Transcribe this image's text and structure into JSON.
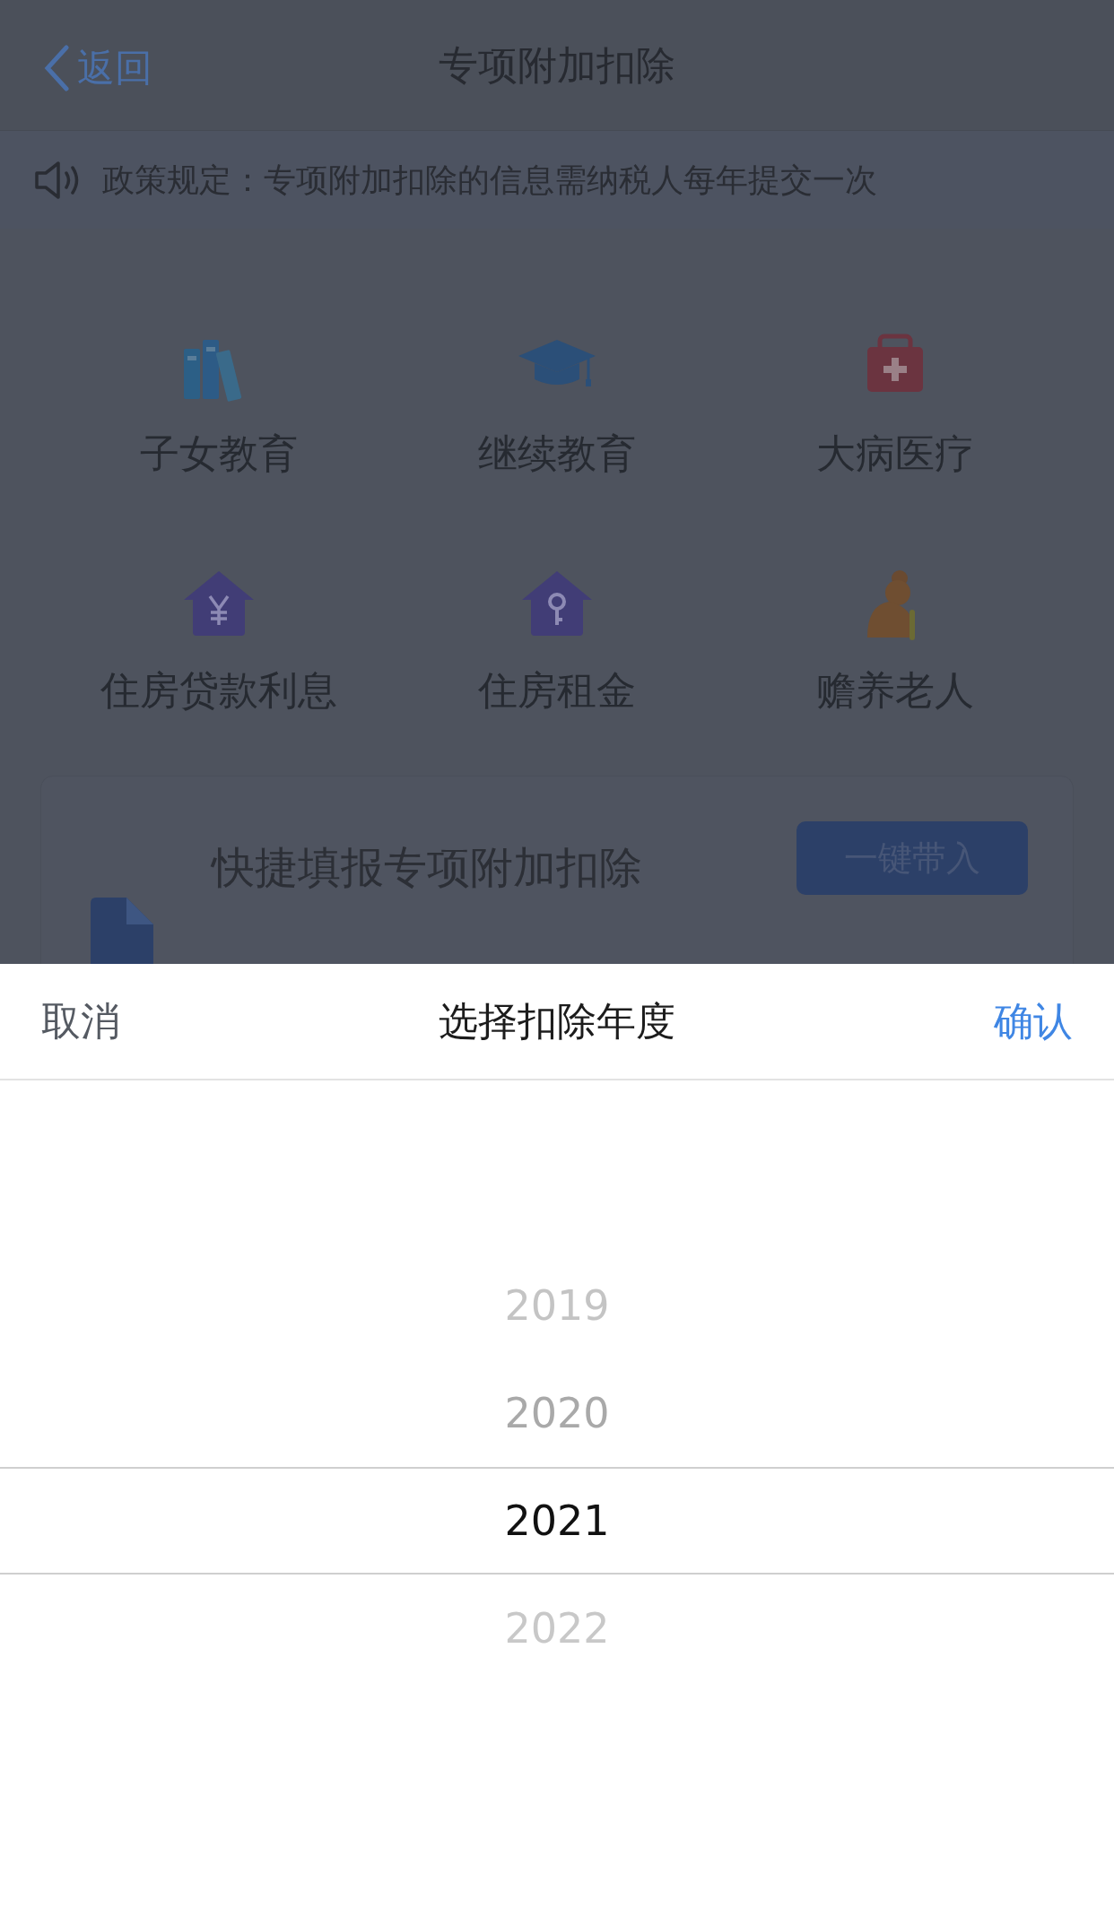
{
  "nav": {
    "back": "返回",
    "title": "专项附加扣除"
  },
  "notice": {
    "text": "政策规定：专项附加扣除的信息需纳税人每年提交一次"
  },
  "categories": [
    {
      "kind": "books",
      "label": "子女教育"
    },
    {
      "kind": "cap",
      "label": "继续教育"
    },
    {
      "kind": "medkit",
      "label": "大病医疗"
    },
    {
      "kind": "house-yen",
      "label": "住房贷款利息"
    },
    {
      "kind": "house-key",
      "label": "住房租金"
    },
    {
      "kind": "elder",
      "label": "赡养老人"
    }
  ],
  "quick_card": {
    "title": "快捷填报专项附加扣除",
    "button": "一键带入"
  },
  "sheet": {
    "cancel": "取消",
    "title": "选择扣除年度",
    "confirm": "确认",
    "years": [
      {
        "label": "2019",
        "selected": false
      },
      {
        "label": "2020",
        "selected": false
      },
      {
        "label": "2021",
        "selected": true
      },
      {
        "label": "2022",
        "selected": false
      }
    ]
  }
}
